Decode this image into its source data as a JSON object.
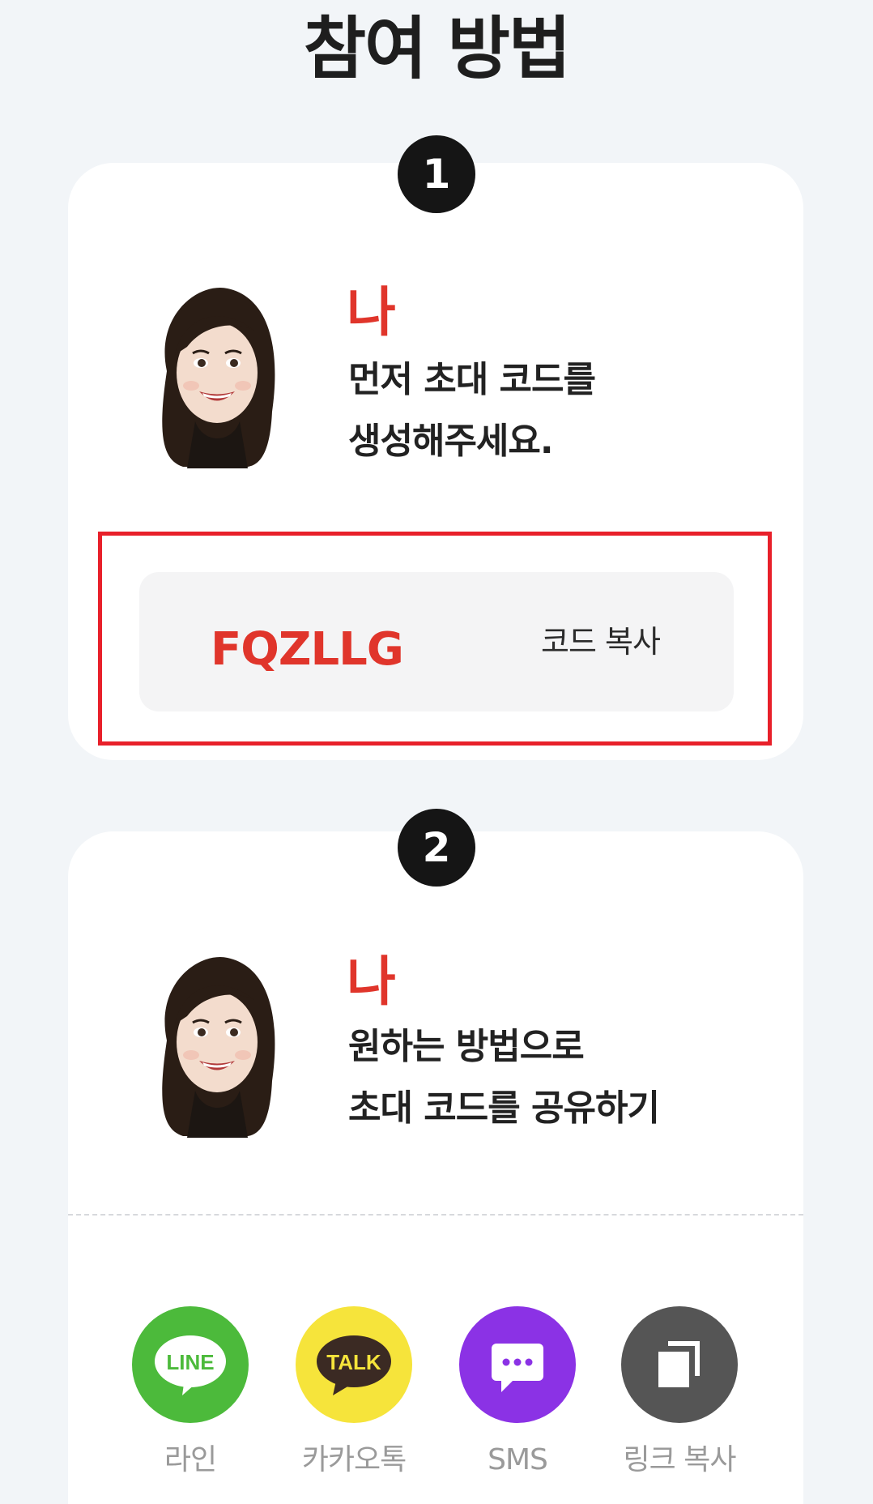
{
  "page": {
    "title": "참여 방법"
  },
  "step1": {
    "number": "1",
    "who": "나",
    "description_line1": "먼저 초대 코드를",
    "description_line2": "생성해주세요.",
    "code": "FQZLLG",
    "copy_label": "코드 복사"
  },
  "step2": {
    "number": "2",
    "who": "나",
    "description_line1": "원하는 방법으로",
    "description_line2": "초대 코드를 공유하기"
  },
  "share": {
    "line": {
      "icon": "line-icon",
      "icon_text": "LINE",
      "label": "라인"
    },
    "kakao": {
      "icon": "kakaotalk-icon",
      "icon_text": "TALK",
      "label": "카카오톡"
    },
    "sms": {
      "icon": "sms-icon",
      "label": "SMS"
    },
    "link": {
      "icon": "copy-link-icon",
      "label": "링크 복사"
    }
  },
  "colors": {
    "accent_red": "#e0352b",
    "highlight_border": "#e8202a",
    "line_green": "#4cba3b",
    "kakao_yellow": "#f6e43b",
    "sms_purple": "#8b32e5",
    "link_gray": "#555555"
  }
}
